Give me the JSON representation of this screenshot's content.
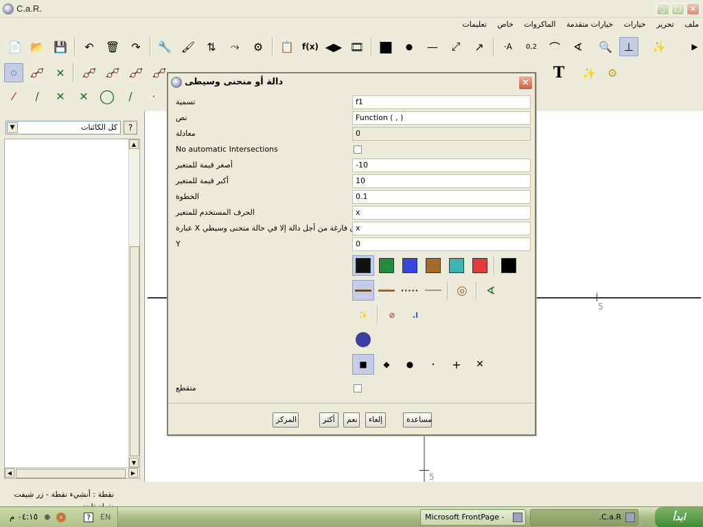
{
  "window": {
    "title": "C.a.R."
  },
  "menu": [
    "ملف",
    "تحرير",
    "خيارات",
    "خيارات متقدمة",
    "الماكروات",
    "خاص",
    "تعليمات"
  ],
  "left_panel": {
    "filter": "كل الكائنات",
    "help_label": "?"
  },
  "canvas": {
    "x_tick_label": "5",
    "y_tick_label": "5"
  },
  "status_text": "نقطة : أنشيء نقطة - زر شيفت نقطة ثابتة",
  "taskbar": {
    "start_label": "ابدأ",
    "tasks": [
      "C.a.R.",
      "Microsoft FrontPage - ..."
    ],
    "clock": "٠٤:١٥ م",
    "lang": "EN"
  },
  "dialog": {
    "title": "دالة أو منحنى وسيطى",
    "close_label": "×",
    "fields": [
      {
        "label": "تسمية",
        "value": "f1"
      },
      {
        "label": "نص",
        "value": "Function ( , )"
      },
      {
        "label": "معادلة",
        "value": "0"
      },
      {
        "label": "No automatic Intersections",
        "value": ""
      },
      {
        "label": "أصغر قيمة للمتغير",
        "value": "-10"
      },
      {
        "label": "أكبر قيمة للمتغير",
        "value": "10"
      },
      {
        "label": "الخطوة",
        "value": "0.1"
      },
      {
        "label": "الحرف المستخدم للمتغير",
        "value": "x"
      },
      {
        "label": "عبارة X تكون فارغة من أجل دالة إلا في حالة منحنى وسيطي",
        "value": "x"
      },
      {
        "label": "Y",
        "value": "0"
      }
    ],
    "dashed_label": "متقطع",
    "colors": [
      "#111111",
      "#228b3c",
      "#3446e0",
      "#a66a2c",
      "#3cb4b4",
      "#e03a3a",
      "#000000"
    ],
    "buttons": {
      "center": "المركز",
      "more": "أكثر",
      "ok": "نعم",
      "cancel": "إلغاء",
      "help": "مساعدة"
    }
  }
}
